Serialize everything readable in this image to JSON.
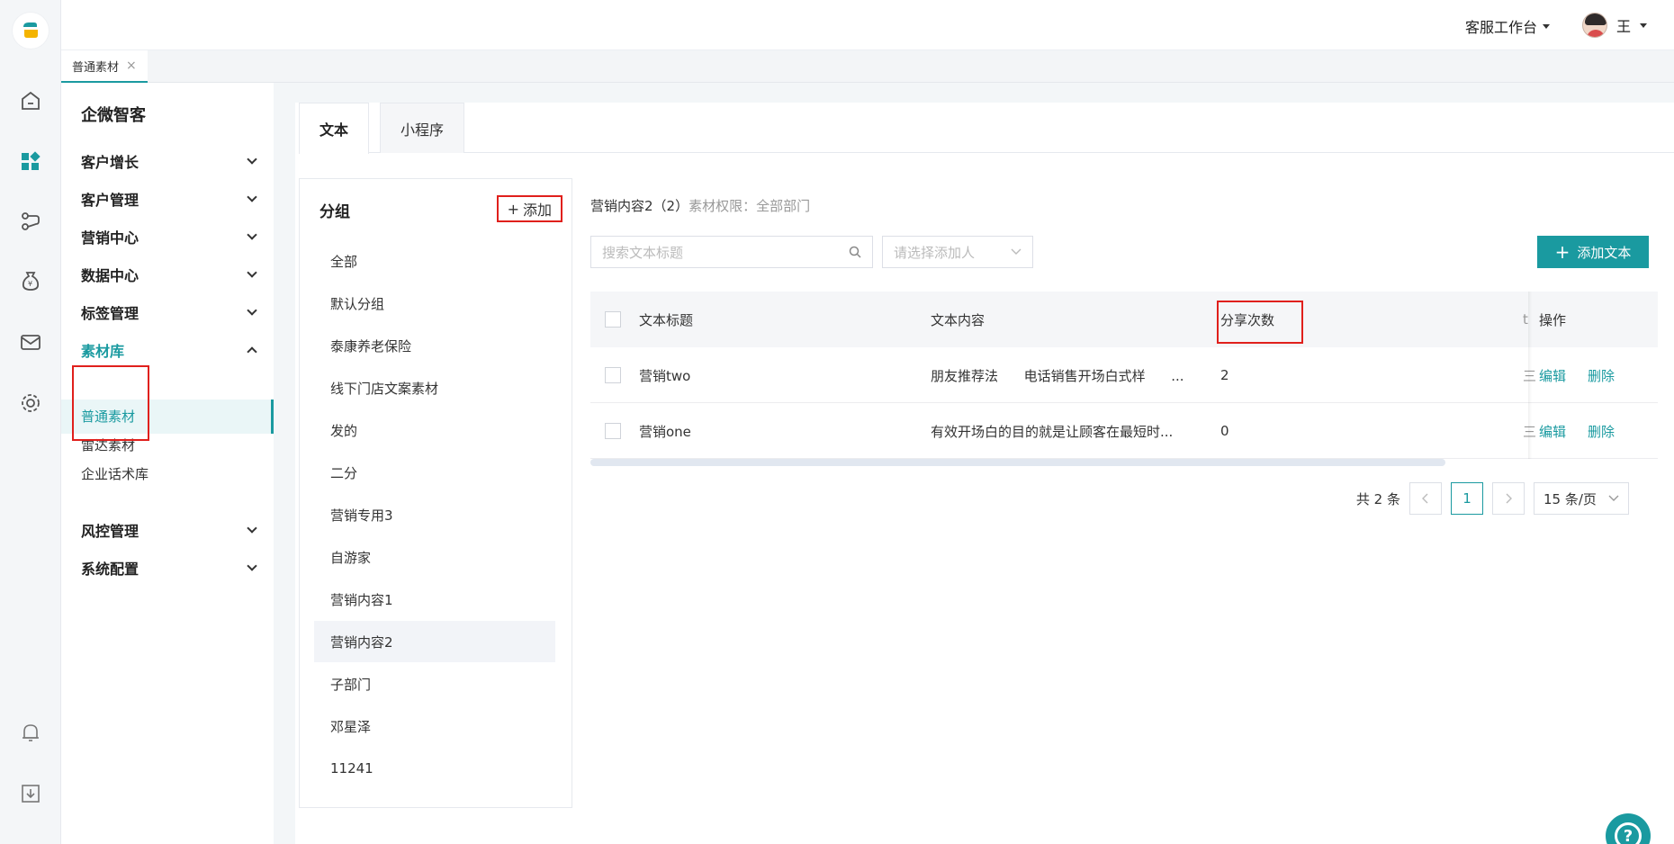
{
  "topbar": {
    "workspace": "客服工作台",
    "user_name": "王"
  },
  "page_tab": {
    "label": "普通素材",
    "close": "×"
  },
  "sidebar": {
    "brand": "企微智客",
    "menus": [
      {
        "label": "客户增长"
      },
      {
        "label": "客户管理"
      },
      {
        "label": "营销中心"
      },
      {
        "label": "数据中心"
      },
      {
        "label": "标签管理"
      },
      {
        "label": "素材库"
      },
      {
        "label": "风控管理"
      },
      {
        "label": "系统配置"
      }
    ],
    "sub_items": [
      {
        "label": "普通素材"
      },
      {
        "label": "雷达素材"
      },
      {
        "label": "企业话术库"
      }
    ]
  },
  "content_tabs": [
    {
      "label": "文本"
    },
    {
      "label": "小程序"
    }
  ],
  "group_panel": {
    "title": "分组",
    "add_label": "添加",
    "groups": [
      {
        "label": "全部"
      },
      {
        "label": "默认分组"
      },
      {
        "label": "泰康养老保险"
      },
      {
        "label": "线下门店文案素材"
      },
      {
        "label": "发的"
      },
      {
        "label": "二分"
      },
      {
        "label": "营销专用3"
      },
      {
        "label": "自游家"
      },
      {
        "label": "营销内容1"
      },
      {
        "label": "营销内容2"
      },
      {
        "label": "子部门"
      },
      {
        "label": "邓星泽"
      },
      {
        "label": "11241"
      }
    ]
  },
  "header_info": {
    "group_name": "营销内容2（2）",
    "perm_label": "素材权限：",
    "perm_value": "全部部门"
  },
  "filters": {
    "search_placeholder": "搜索文本标题",
    "select_placeholder": "请选择添加人",
    "add_text_label": "添加文本"
  },
  "table": {
    "columns": {
      "title": "文本标题",
      "content": "文本内容",
      "shares": "分享次数",
      "clipped": "t",
      "ops": "操作"
    },
    "rows": [
      {
        "title": "营销two",
        "content": "朋友推荐法      电话销售开场白式样      ...",
        "shares": "2",
        "clipped": "三"
      },
      {
        "title": "营销one",
        "content": "有效开场白的目的就是让顾客在最短时...",
        "shares": "0",
        "clipped": "三"
      }
    ],
    "edit_label": "编辑",
    "delete_label": "删除"
  },
  "pager": {
    "total": "共 2 条",
    "current": "1",
    "page_size": "15 条/页"
  },
  "help_label": "?",
  "colors": {
    "accent": "#1a9aa0",
    "highlight_box": "#e0201c"
  }
}
